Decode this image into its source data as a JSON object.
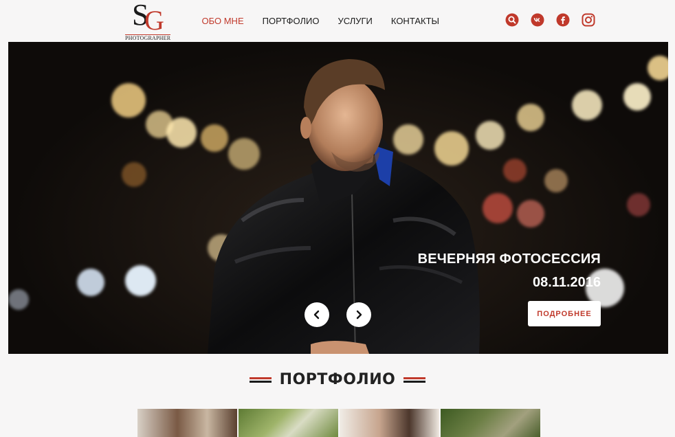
{
  "header": {
    "logo": {
      "letters": "SG",
      "subtitle": "PHOTOGRAPHER"
    },
    "nav": [
      {
        "label": "ОБО МНЕ",
        "active": true
      },
      {
        "label": "ПОРТФОЛИО",
        "active": false
      },
      {
        "label": "УСЛУГИ",
        "active": false
      },
      {
        "label": "КОНТАКТЫ",
        "active": false
      }
    ],
    "social": [
      {
        "icon": "search-icon",
        "glyph": "⚲"
      },
      {
        "icon": "vk-icon",
        "glyph": "vk"
      },
      {
        "icon": "facebook-icon",
        "glyph": "f"
      },
      {
        "icon": "instagram-icon",
        "glyph": ""
      }
    ]
  },
  "hero": {
    "title": "ВЕЧЕРНЯЯ ФОТОСЕССИЯ",
    "date": "08.11.2016",
    "button_label": "ПОДРОБНЕЕ",
    "prev_glyph": "‹",
    "next_glyph": "›"
  },
  "portfolio": {
    "title": "ПОРТФОЛИО"
  },
  "colors": {
    "accent": "#c0392b",
    "text": "#1a1a1a",
    "background": "#f7f6f6"
  }
}
